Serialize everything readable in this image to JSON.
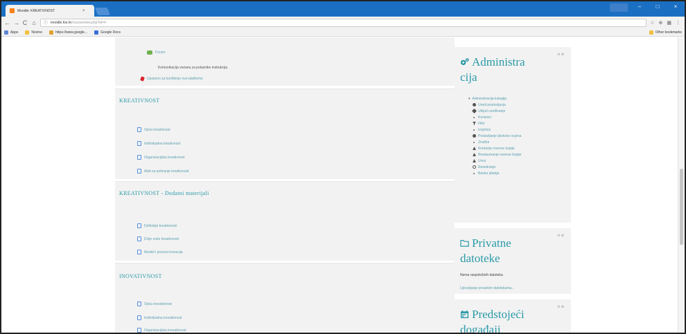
{
  "browser": {
    "tab_title": "Moodle: KREATIVNOST",
    "tab_close": "×",
    "url_host": "moodle.fos.hr",
    "url_path": "/course/view.php?id=4",
    "nav": {
      "back": "←",
      "forward": "→",
      "reload": "C",
      "home": "⌂",
      "info": "ⓘ"
    },
    "window": {
      "minimize": "–",
      "maximize": "□",
      "close": "×"
    },
    "right_icons": [
      "☆",
      "⊕",
      "▦",
      "⋮"
    ],
    "bookmarks": [
      {
        "label": "Apps",
        "color": "#5f88d6"
      },
      {
        "label": "Novine",
        "color": "#f0c040"
      },
      {
        "label": "https://www.google...",
        "color": "#e0a030"
      },
      {
        "label": "Google Docs",
        "color": "#3a6fd6"
      }
    ],
    "other_bookmarks": "Other bookmarks"
  },
  "main": {
    "top_items": [
      {
        "type": "forum",
        "label": "Forum"
      },
      {
        "type": "text",
        "label": "Komunikacija vezana za polaznike instrukcija"
      },
      {
        "type": "pin",
        "label": "Uputstvo za korištenje ove platforme"
      }
    ],
    "sections": [
      {
        "title": "KREATIVNOST",
        "items": [
          "Opća kreativnost",
          "Individualna kreativnost",
          "Organizacijska kreativnost",
          "Alati za poticanje kreativnosti"
        ]
      },
      {
        "title": "KREATIVNOST - Dodatni materijali",
        "items": [
          "Definicije kreativnosti",
          "Dvije vrste kreativnosti",
          "Modeli i procesi inovacija"
        ]
      },
      {
        "title": "INOVATIVNOST",
        "items": [
          "Opća inovativnost",
          "Individualna inovativnost",
          "Organizacijska inovativnost"
        ]
      }
    ]
  },
  "sidebar": {
    "admin": {
      "title_line1": "Administra",
      "title_line2": "cija",
      "control": "⊖ ⊕",
      "root": "Administracija kolegija",
      "items": [
        {
          "icon": "gear",
          "label": "Uredi postavljanja"
        },
        {
          "icon": "pencil",
          "label": "Uključi uređivanje"
        },
        {
          "icon": "dot",
          "label": "Korisnici"
        },
        {
          "icon": "filter",
          "label": "Filtri"
        },
        {
          "icon": "dot",
          "label": "Izvješća"
        },
        {
          "icon": "gear",
          "label": "Postavljanje ljestvice ocjena"
        },
        {
          "icon": "dot",
          "label": "Značke"
        },
        {
          "icon": "triangle",
          "label": "Kreiranje rezerve kopije"
        },
        {
          "icon": "triangle",
          "label": "Restauriranje rezerve kopije"
        },
        {
          "icon": "triangle",
          "label": "Uvoz"
        },
        {
          "icon": "circle",
          "label": "Resetiranje"
        },
        {
          "icon": "dot",
          "label": "Banka pitanja"
        }
      ]
    },
    "files": {
      "title_line1": "Privatne",
      "title_line2": "datoteke",
      "control": "⊖ ⊕",
      "empty_text": "Nema raspoloživih datoteka",
      "manage_link": "Upravljanje privatnim datotekama..."
    },
    "events": {
      "title_line1": "Predstojeći",
      "title_line2": "događaji",
      "control": "⊖ ⊕"
    }
  }
}
